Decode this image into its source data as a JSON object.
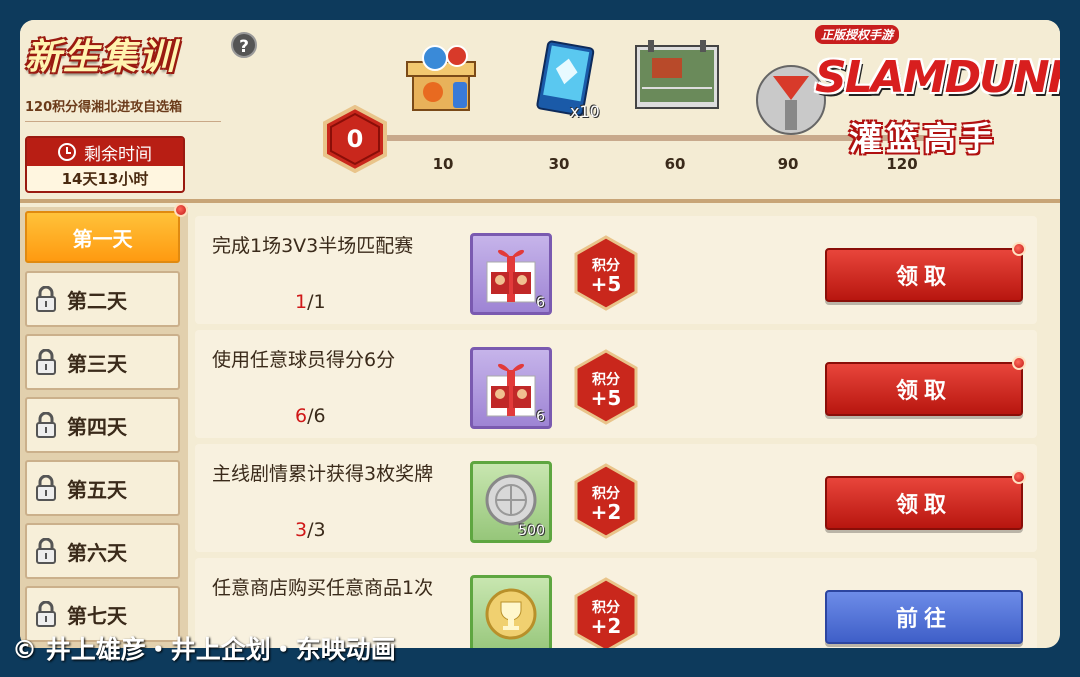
{
  "event": {
    "title": "新生集训",
    "help_icon": "?",
    "subtitle": "120积分得湘北进攻自选箱",
    "timer_label": "剩余时间",
    "timer_value": "14天13小时"
  },
  "progress": {
    "current_score": "0",
    "milestones": [
      "10",
      "30",
      "60",
      "90",
      "120"
    ],
    "reward_icons": [
      "gift-crate-icon",
      "blue-card-icon",
      "calendar-court-icon",
      "mascot-icon"
    ],
    "card_count": "x10"
  },
  "logo": {
    "tag": "正版授权手游",
    "name": "SLAMDUNK",
    "cn": "灌篮高手"
  },
  "days": [
    "第一天",
    "第二天",
    "第三天",
    "第四天",
    "第五天",
    "第六天",
    "第七天"
  ],
  "tasks": [
    {
      "desc": "完成1场3V3半场匹配赛",
      "cur": "1",
      "total": "/1",
      "item_count": "6",
      "pts_label": "积分",
      "pts_value": "+5",
      "button": "领取"
    },
    {
      "desc": "使用任意球员得分6分",
      "cur": "6",
      "total": "/6",
      "item_count": "6",
      "pts_label": "积分",
      "pts_value": "+5",
      "button": "领取"
    },
    {
      "desc": "主线剧情累计获得3枚奖牌",
      "cur": "3",
      "total": "/3",
      "item_count": "500",
      "pts_label": "积分",
      "pts_value": "+2",
      "button": "领取"
    },
    {
      "desc": "任意商店购买任意商品1次",
      "pts_label": "积分",
      "pts_value": "+2",
      "button": "前往"
    }
  ],
  "copyright": "© 井上雄彦・井上企划・东映动画",
  "colors": {
    "accent_red": "#b81e14",
    "orange_tab": "#ffa91f",
    "blue_button": "#4f6fd8"
  }
}
